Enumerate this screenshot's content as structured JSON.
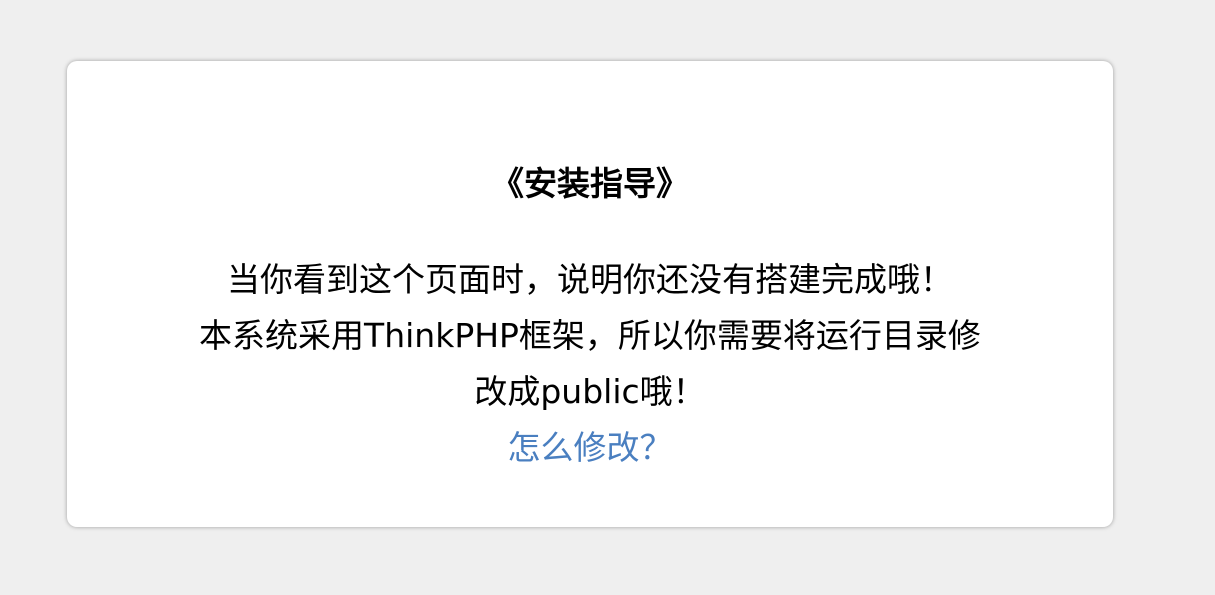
{
  "card": {
    "title": "《安装指导》",
    "message_line_1": "当你看到这个页面时，说明你还没有搭建完成哦！",
    "message_line_2": "本系统采用ThinkPHP框架，所以你需要将运行目录修",
    "message_line_3": "改成public哦！",
    "help_link": "怎么修改？"
  },
  "colors": {
    "page_background": "#efefef",
    "card_background": "#ffffff",
    "link": "#4a7fc0",
    "text": "#000000"
  }
}
